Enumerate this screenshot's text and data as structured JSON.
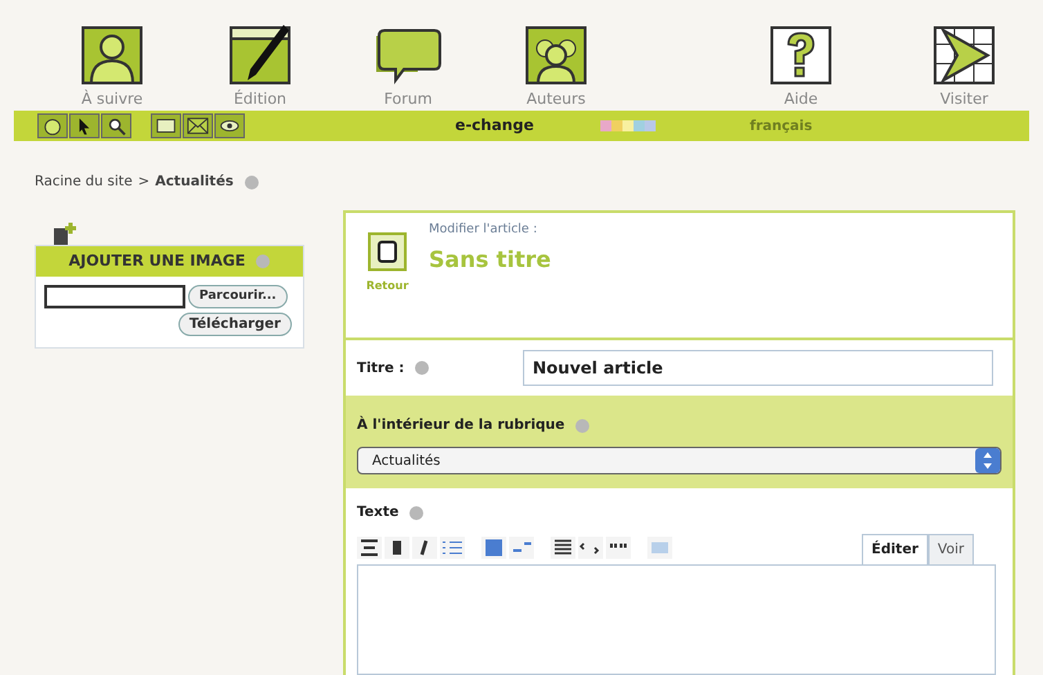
{
  "nav": [
    {
      "label": "À suivre",
      "kind": "person"
    },
    {
      "label": "Édition",
      "kind": "pen"
    },
    {
      "label": "Forum",
      "kind": "bubble"
    },
    {
      "label": "Auteurs",
      "kind": "people"
    },
    {
      "label": "Aide",
      "kind": "help"
    },
    {
      "label": "Visiter",
      "kind": "visit"
    }
  ],
  "bar": {
    "site": "e-change",
    "swatches": [
      {
        "color": "#e8a8c8"
      },
      {
        "color": "#f0d060"
      },
      {
        "color": "#f8f0a0"
      },
      {
        "color": "#a0d0e0"
      },
      {
        "color": "#b8c8e8"
      }
    ],
    "language": "français"
  },
  "breadcrumb": {
    "root": "Racine du site",
    "separator": ">",
    "current": "Actualités"
  },
  "upload": {
    "title": "AJOUTER UNE IMAGE",
    "browse": "Parcourir...",
    "submit": "Télécharger"
  },
  "article": {
    "back": "Retour",
    "caption": "Modifier l'article :",
    "title": "Sans titre"
  },
  "form": {
    "title_label": "Titre :",
    "title_value": "Nouvel article",
    "section_label": "À l'intérieur de la rubrique",
    "section_value": "Actualités",
    "text_label": "Texte",
    "tabs": [
      {
        "label": "Éditer",
        "selected": true
      },
      {
        "label": "Voir",
        "selected": false
      }
    ]
  }
}
